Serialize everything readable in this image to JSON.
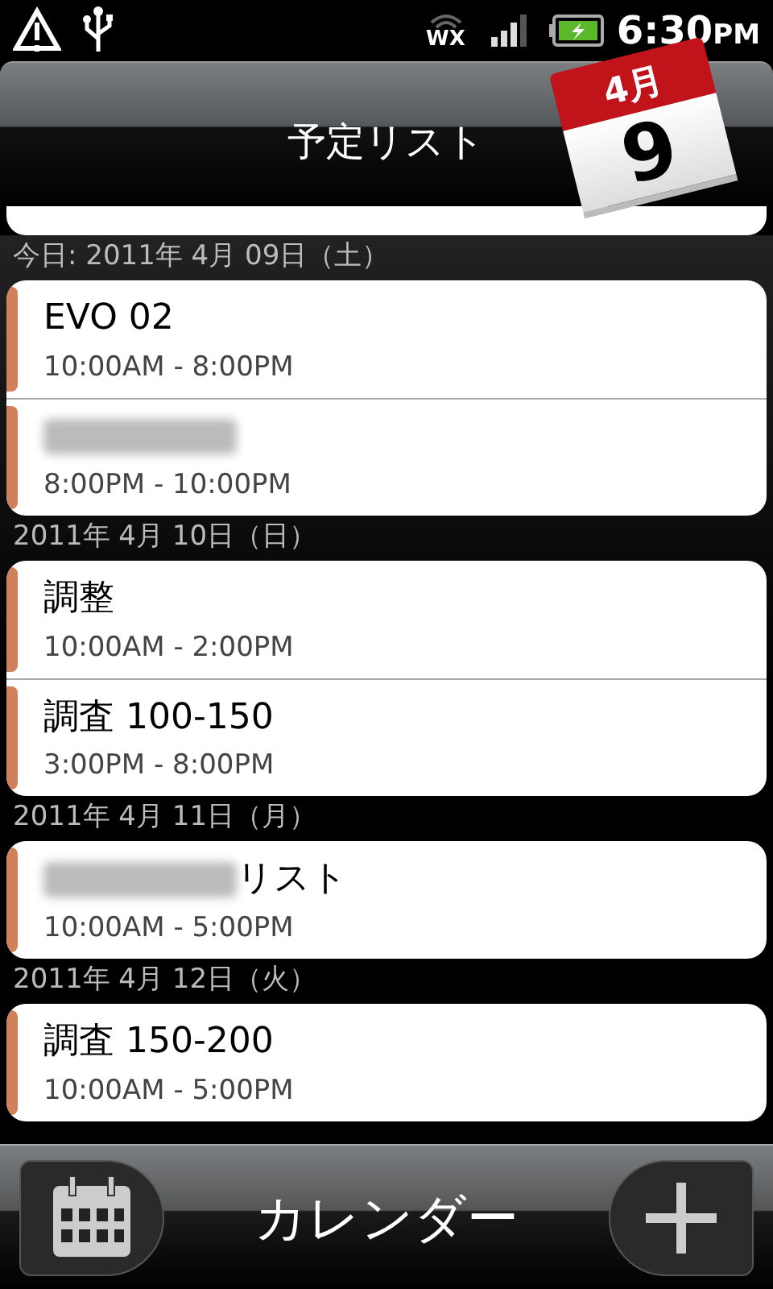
{
  "status_bar": {
    "wifi_label": "WX",
    "time": "6:30",
    "ampm": "PM"
  },
  "header": {
    "title": "予定リスト",
    "badge_month": "4月",
    "badge_day": "9"
  },
  "days": [
    {
      "date": "今日: 2011年 4月 09日（土）",
      "events": [
        {
          "title": "EVO 02",
          "time": "10:00AM - 8:00PM",
          "redacted": false
        },
        {
          "redacted": true,
          "time": "8:00PM - 10:00PM"
        }
      ]
    },
    {
      "date": "2011年 4月 10日（日）",
      "events": [
        {
          "title": "調整",
          "time": "10:00AM - 2:00PM",
          "redacted": false
        },
        {
          "title": "調査 100-150",
          "time": "3:00PM - 8:00PM",
          "redacted": false
        }
      ]
    },
    {
      "date": "2011年 4月 11日（月）",
      "events": [
        {
          "title": "リスト",
          "time": "10:00AM - 5:00PM",
          "redacted": true
        }
      ]
    },
    {
      "date": "2011年 4月 12日（火）",
      "events": [
        {
          "title": "調査 150-200",
          "time": "10:00AM - 5:00PM",
          "redacted": false
        }
      ]
    }
  ],
  "bottom_bar": {
    "title": "カレンダー"
  }
}
